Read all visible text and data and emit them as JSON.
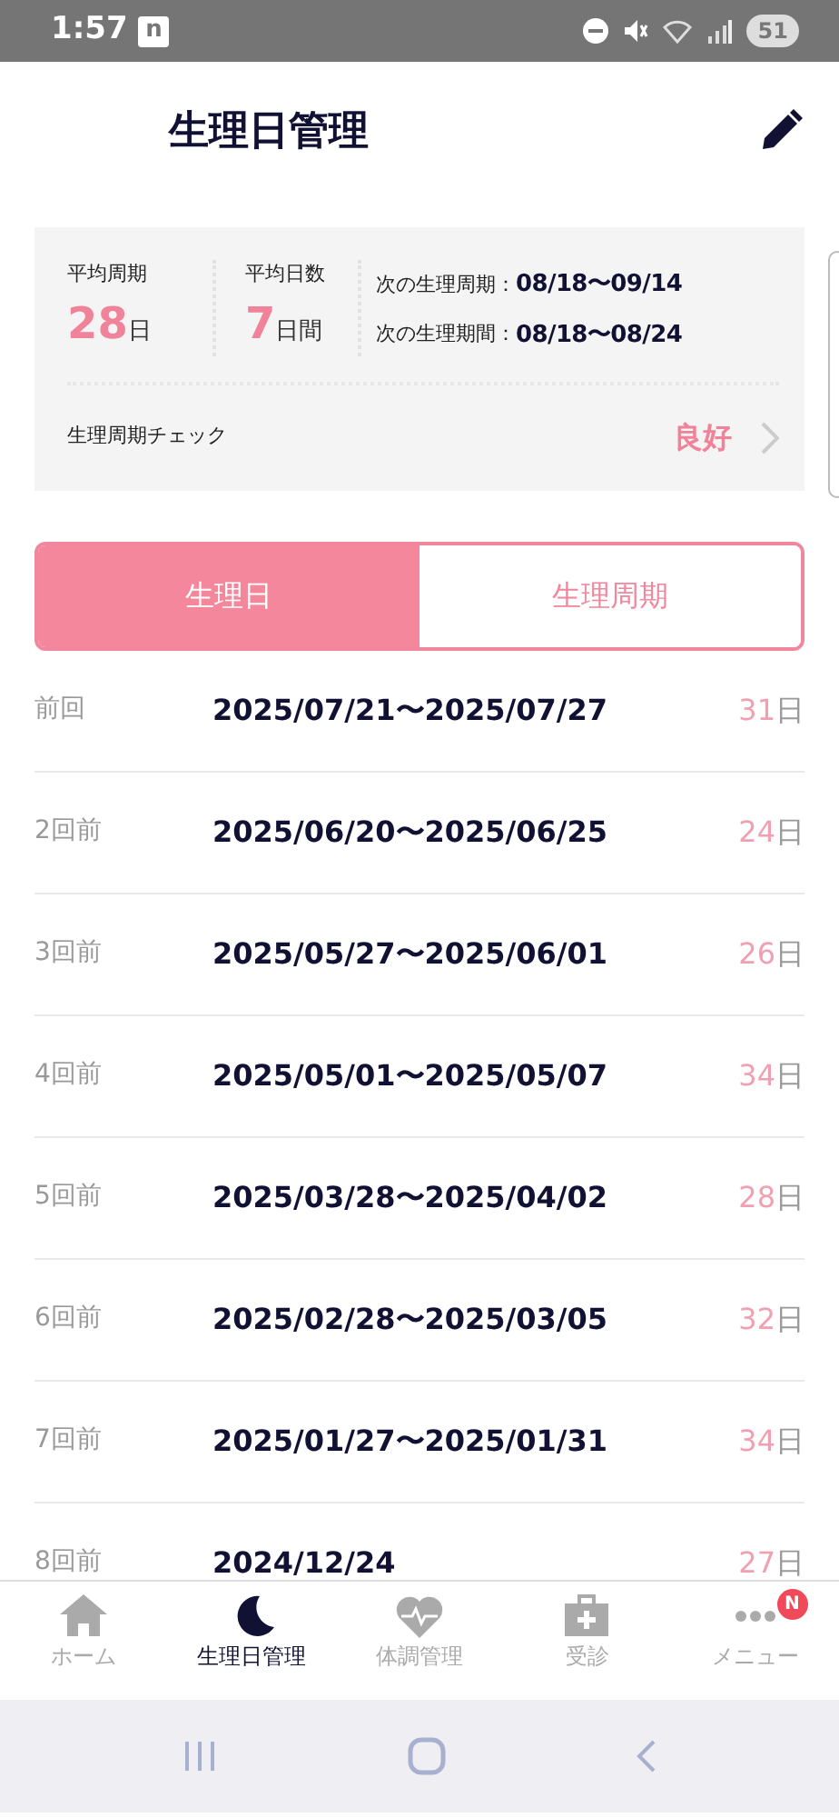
{
  "status_bar": {
    "time": "1:57",
    "notification": "n",
    "battery": "51"
  },
  "header": {
    "title": "生理日管理"
  },
  "summary": {
    "avg_cycle": {
      "label": "平均周期",
      "value": "28",
      "unit": "日"
    },
    "avg_days": {
      "label": "平均日数",
      "value": "7",
      "unit": "日間"
    },
    "next": [
      {
        "label": "次の生理周期：",
        "value": "08/18〜09/14"
      },
      {
        "label": "次の生理期間：",
        "value": "08/18〜08/24"
      }
    ],
    "check": {
      "label": "生理周期チェック",
      "value": "良好"
    }
  },
  "tabs": [
    {
      "label": "生理日",
      "selected": true
    },
    {
      "label": "生理周期",
      "selected": false
    }
  ],
  "history": [
    {
      "label": "前回",
      "dates": "2025/07/21〜2025/07/27",
      "days": "31",
      "unit": "日"
    },
    {
      "label": "2回前",
      "dates": "2025/06/20〜2025/06/25",
      "days": "24",
      "unit": "日"
    },
    {
      "label": "3回前",
      "dates": "2025/05/27〜2025/06/01",
      "days": "26",
      "unit": "日"
    },
    {
      "label": "4回前",
      "dates": "2025/05/01〜2025/05/07",
      "days": "34",
      "unit": "日"
    },
    {
      "label": "5回前",
      "dates": "2025/03/28〜2025/04/02",
      "days": "28",
      "unit": "日"
    },
    {
      "label": "6回前",
      "dates": "2025/02/28〜2025/03/05",
      "days": "32",
      "unit": "日"
    },
    {
      "label": "7回前",
      "dates": "2025/01/27〜2025/01/31",
      "days": "34",
      "unit": "日"
    },
    {
      "label": "8回前",
      "dates": "2024/12/24",
      "days": "27",
      "unit": "日"
    }
  ],
  "bottom_nav": [
    {
      "kind": "home",
      "label": "ホーム",
      "selected": false
    },
    {
      "kind": "moon",
      "label": "生理日管理",
      "selected": true
    },
    {
      "kind": "heart",
      "label": "体調管理",
      "selected": false
    },
    {
      "kind": "clinic",
      "label": "受診",
      "selected": false
    },
    {
      "kind": "menu",
      "label": "メニュー",
      "selected": false,
      "badge": "N"
    }
  ]
}
